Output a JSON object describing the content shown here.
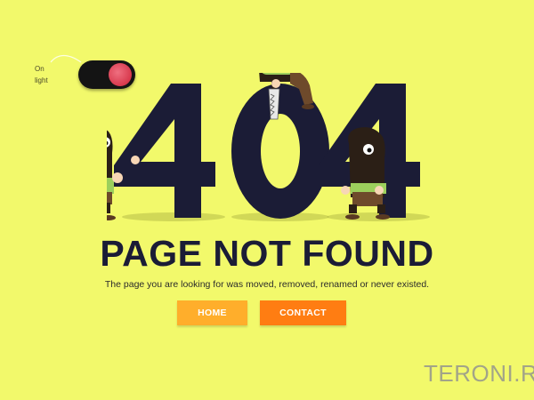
{
  "light_toggle": {
    "label_line1": "On",
    "label_line2": "light",
    "state": "off",
    "knob_color": "#d8394d"
  },
  "hero": {
    "code": "404",
    "digit_color": "#1b1c36"
  },
  "main": {
    "title": "PAGE NOT FOUND",
    "message": "The page you are looking for was moved, removed, renamed or never existed."
  },
  "buttons": {
    "home_label": "HOME",
    "contact_label": "CONTACT",
    "home_color": "#ffae2b",
    "contact_color": "#ff7d12"
  },
  "watermark": {
    "text": "TERONI.RU"
  },
  "colors": {
    "background": "#f2f96b",
    "character_body": "#2b1f16",
    "character_shirt": "#9ccf5c",
    "character_pants": "#6e4a2b"
  }
}
